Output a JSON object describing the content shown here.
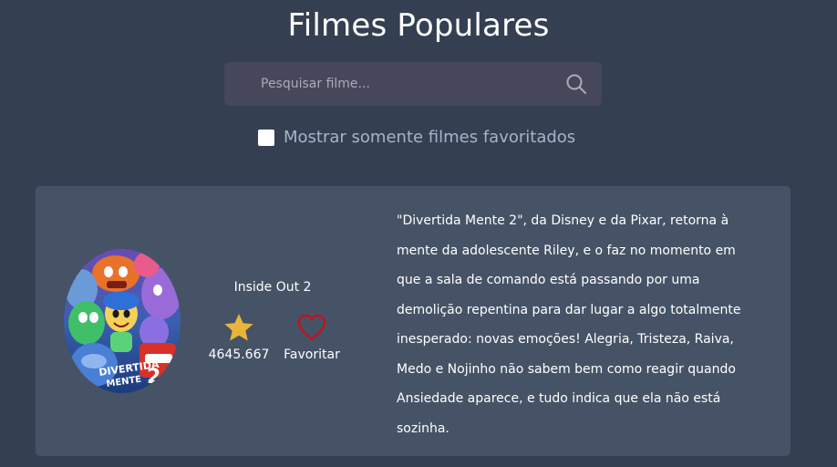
{
  "header": {
    "title": "Filmes Populares"
  },
  "search": {
    "placeholder": "Pesquisar filme...",
    "value": "",
    "icon": "search-icon"
  },
  "filter": {
    "label": "Mostrar somente filmes favoritados",
    "checked": false
  },
  "movies": [
    {
      "title": "Inside Out 2",
      "poster_text": "DIVERTIDA MENTE 2",
      "rating": "4645.667",
      "rating_icon": "star-icon",
      "favorite_label": "Favoritar",
      "favorite_icon": "heart-outline-icon",
      "overview": "\"Divertida Mente 2\", da Disney e da Pixar, retorna à mente da adolescente Riley, e o faz no momento em que a sala de comando está passando por uma demolição repentina para dar lugar a algo totalmente inesperado: novas emoções! Alegria, Tristeza, Raiva, Medo e Nojinho não sabem bem como reagir quando Ansiedade aparece, e tudo indica que ela não está sozinha."
    }
  ],
  "colors": {
    "background": "#343f51",
    "card": "#465366",
    "search_bg": "#46475b",
    "star": "#e6b53a",
    "heart": "#c1121f",
    "muted_text": "#a7b4c8"
  }
}
